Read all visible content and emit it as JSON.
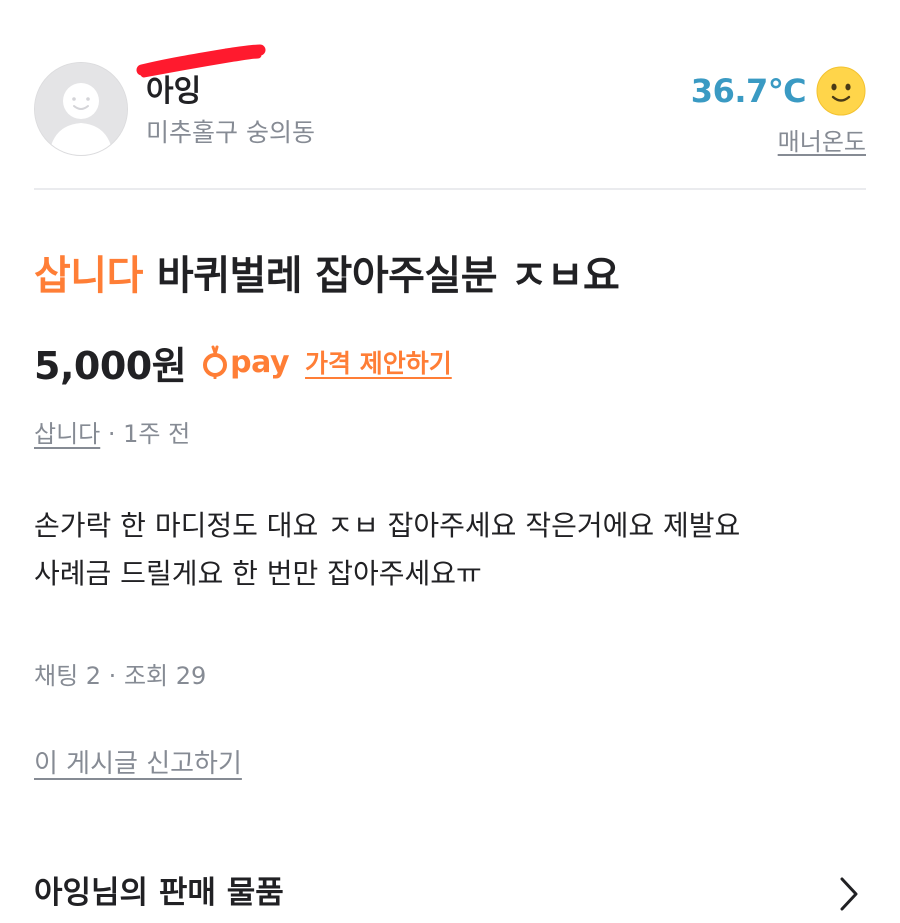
{
  "profile": {
    "nickname": "아잉",
    "location": "미추홀구 숭의동",
    "manner_temperature": "36.7℃",
    "manner_label": "매너온도",
    "temperature_icon": "smiley-face-icon"
  },
  "post": {
    "tag": "삽니다",
    "title": "바퀴벌레 잡아주실분 ㅈㅂ요",
    "price": "5,000원",
    "pay_label": "pay",
    "offer_link": "가격 제안하기",
    "category": "삽니다",
    "time": " · 1주 전",
    "description_lines": [
      "손가락 한 마디정도 대요 ㅈㅂ 잡아주세요 작은거에요 제발요",
      "사례금 드릴게요 한 번만 잡아주세요ㅠ"
    ],
    "stats": "채팅 2 · 조회 29",
    "report_link": "이 게시글 신고하기"
  },
  "seller_items": {
    "label": "아잉님의 판매 물품",
    "icon": "chevron-right-icon"
  },
  "colors": {
    "accent": "#ff7e36",
    "temperature": "#3a9ac3",
    "muted": "#868b94",
    "text": "#212124",
    "redaction": "#ff1a2e"
  }
}
